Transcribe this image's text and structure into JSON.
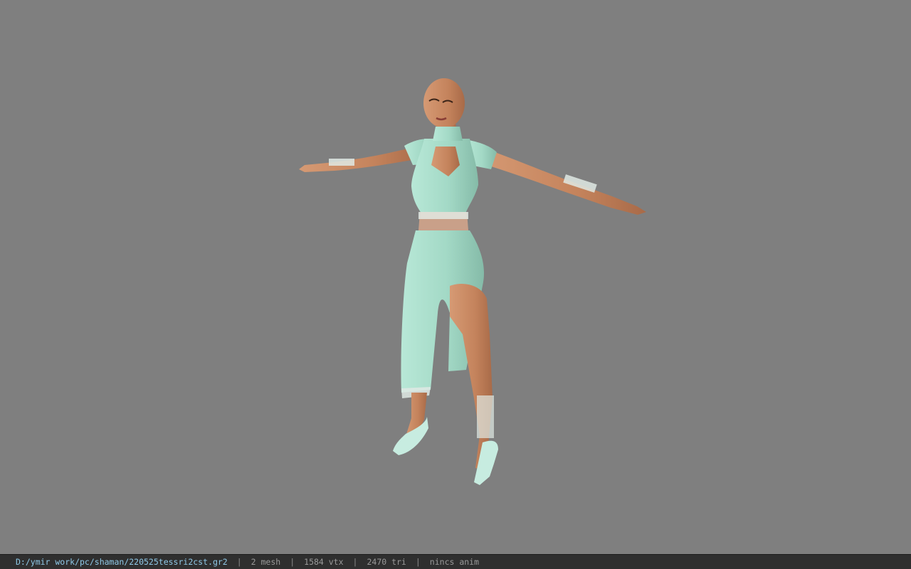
{
  "viewer": {
    "background_color": "#7f7f7f",
    "model": {
      "description_icon": "character-model-icon",
      "skin_color": "#c98c64",
      "dress_color": "#a6dcc9",
      "lace_color": "#e6eee9"
    }
  },
  "status": {
    "file_path": "D:/ymir work/pc/shaman/220525tessri2cst.gr2",
    "separator": "|",
    "mesh_count": "2 mesh",
    "vertex_count": "1584 vtx",
    "triangle_count": "2470 tri",
    "animation": "nincs anim"
  }
}
